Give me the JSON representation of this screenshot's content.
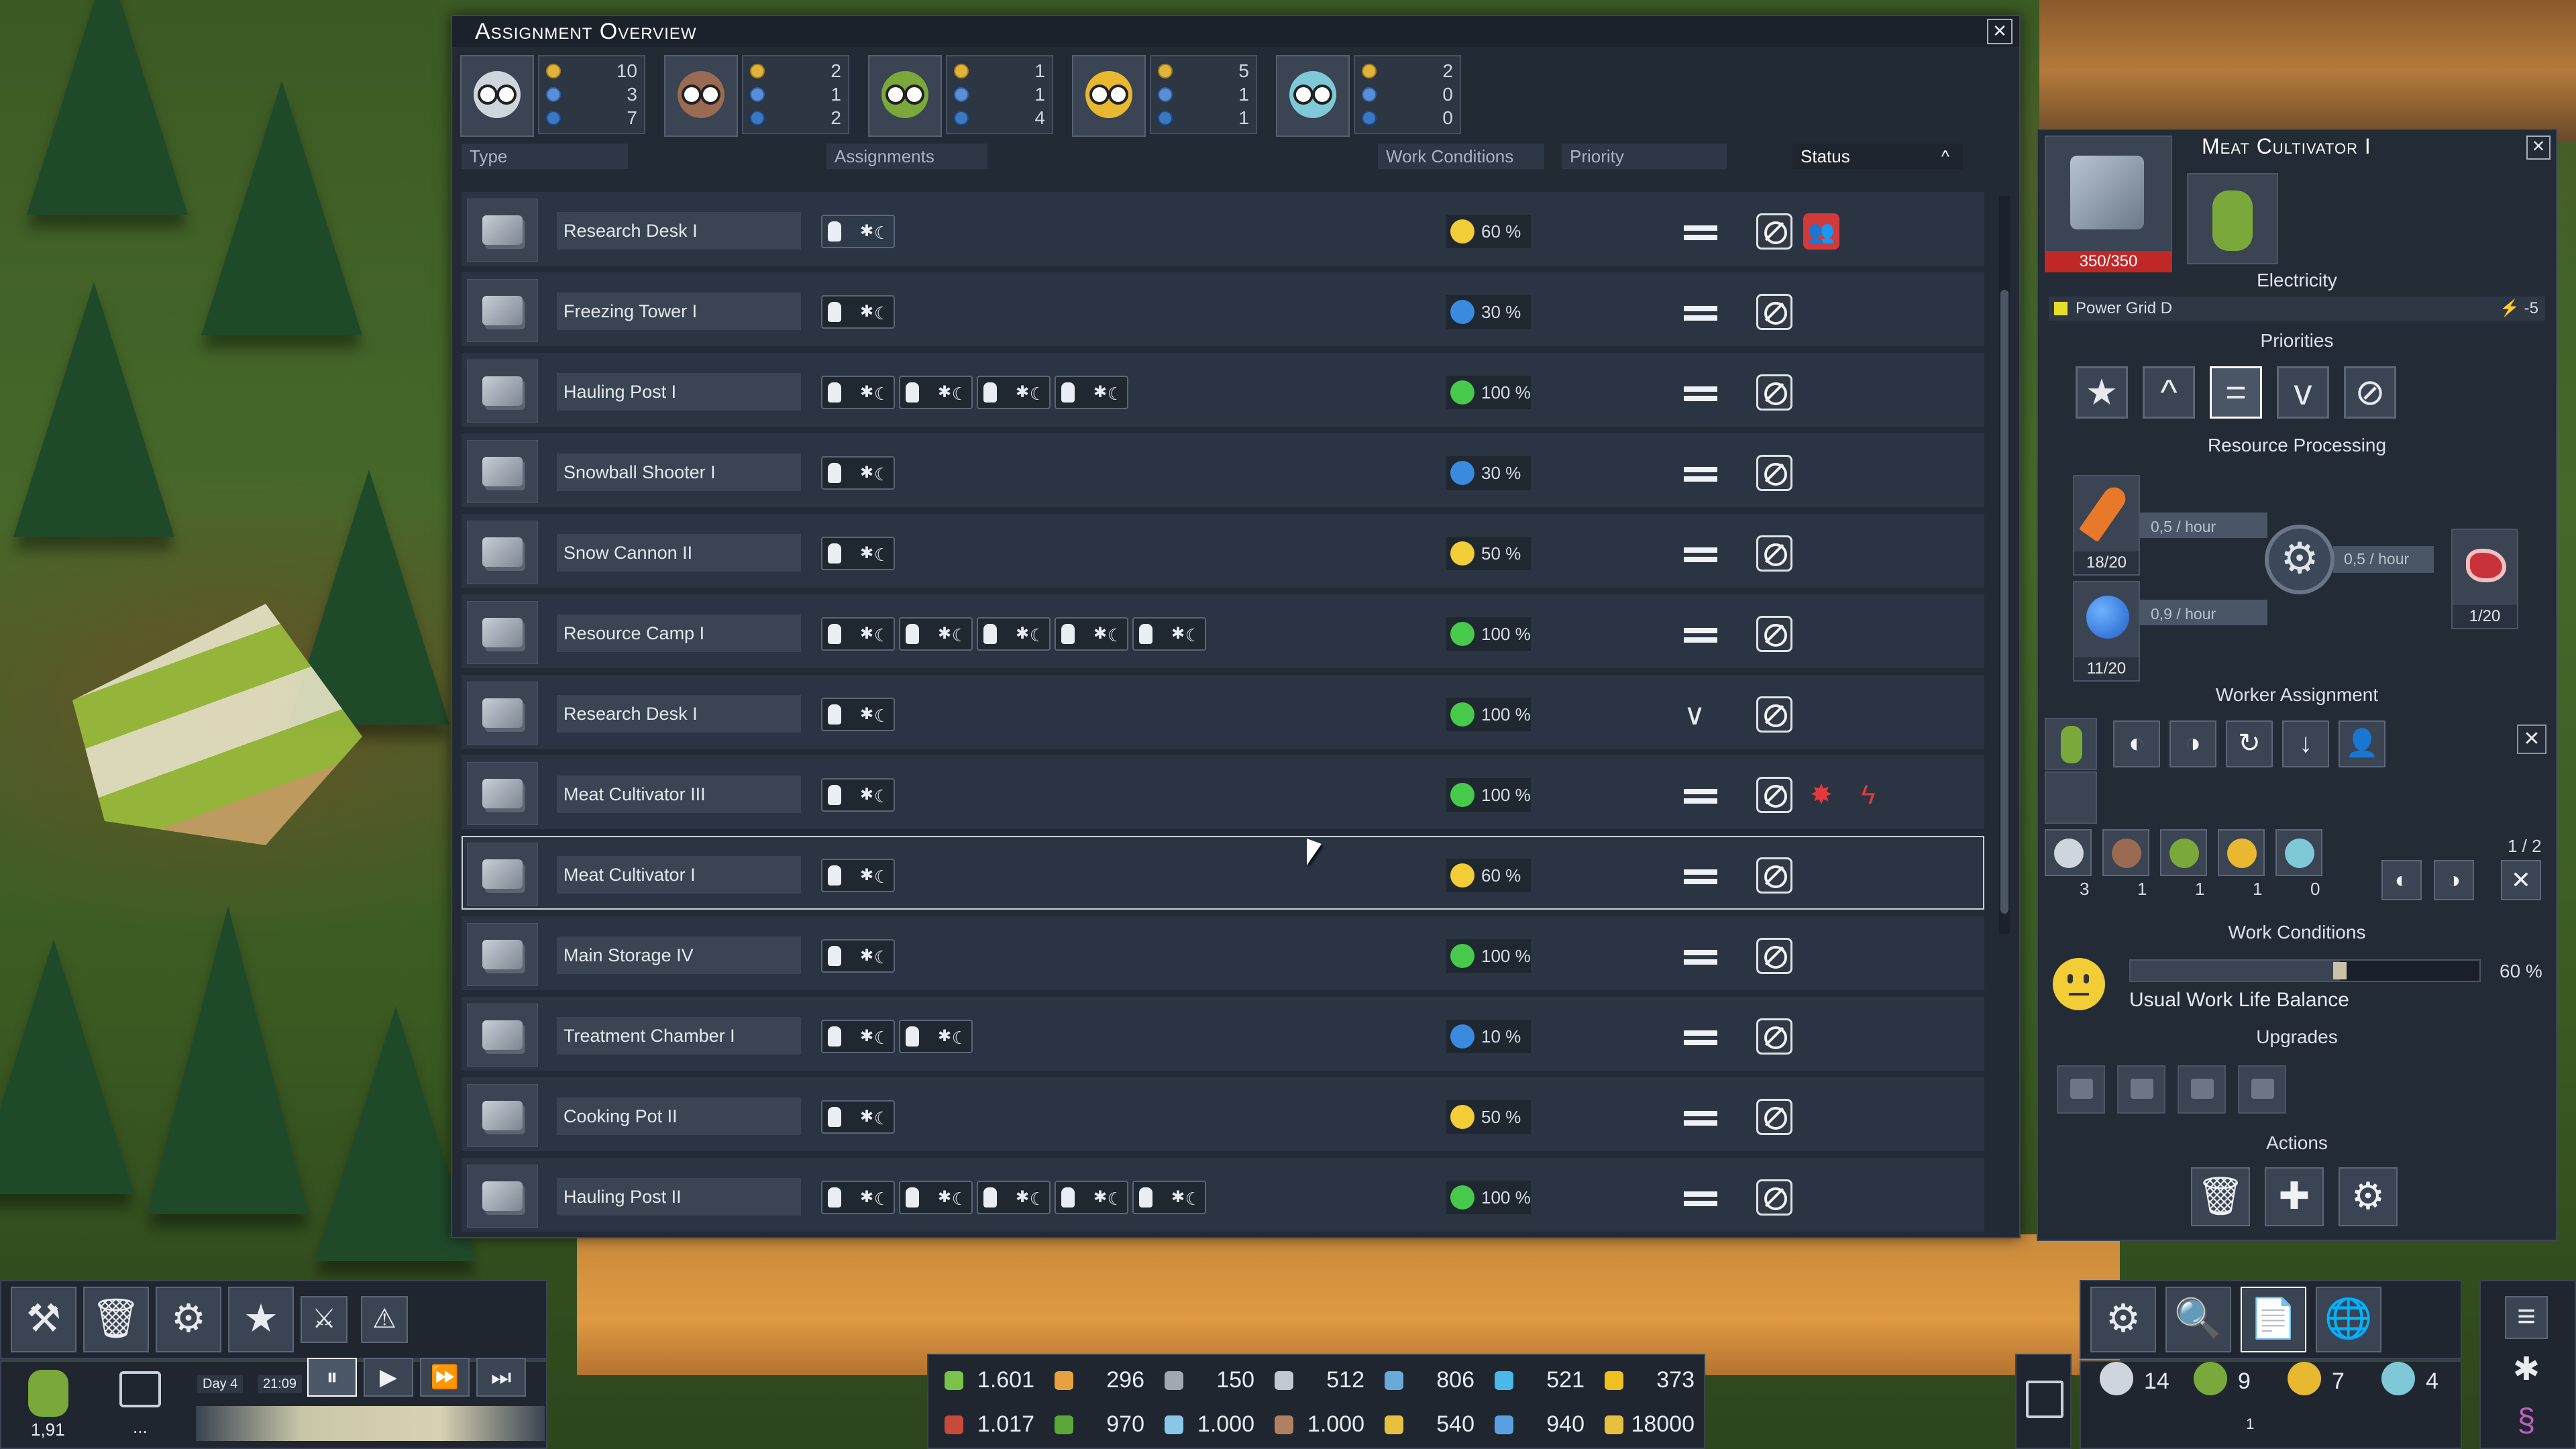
{
  "overview": {
    "title": "Assignment Overview",
    "close": "✕",
    "species": [
      {
        "name": "worker-type-1",
        "color": "#cfd5dc",
        "stats": [
          "10",
          "3",
          "7"
        ]
      },
      {
        "name": "worker-type-2",
        "color": "#9a6a52",
        "stats": [
          "2",
          "1",
          "2"
        ]
      },
      {
        "name": "worker-type-3",
        "color": "#7aa83a",
        "stats": [
          "1",
          "1",
          "4"
        ]
      },
      {
        "name": "worker-type-4",
        "color": "#e8b830",
        "stats": [
          "5",
          "1",
          "1"
        ]
      },
      {
        "name": "worker-type-5",
        "color": "#7fc8d8",
        "stats": [
          "2",
          "0",
          "0"
        ]
      }
    ],
    "columns": {
      "type": "Type",
      "assignments": "Assignments",
      "work_conditions": "Work Conditions",
      "priority": "Priority",
      "status": "Status",
      "status_sort": "^"
    },
    "rows": [
      {
        "name": "Research Desk I",
        "slots": 1,
        "empty": 1,
        "wc": "60 %",
        "mood": "neutral",
        "priority": "equal",
        "status": [
          "ban",
          "red"
        ]
      },
      {
        "name": "Freezing Tower I",
        "slots": 1,
        "empty": 0,
        "wc": "30 %",
        "mood": "sad",
        "priority": "equal",
        "status": [
          "ban"
        ]
      },
      {
        "name": "Hauling Post I",
        "slots": 4,
        "empty": 0,
        "wc": "100 %",
        "mood": "happy",
        "priority": "equal",
        "status": [
          "ban"
        ]
      },
      {
        "name": "Snowball Shooter I",
        "slots": 1,
        "empty": 0,
        "wc": "30 %",
        "mood": "sad",
        "priority": "equal",
        "status": [
          "ban"
        ]
      },
      {
        "name": "Snow Cannon II",
        "slots": 1,
        "empty": 0,
        "wc": "50 %",
        "mood": "neutral",
        "priority": "equal",
        "status": [
          "ban"
        ]
      },
      {
        "name": "Resource Camp I",
        "slots": 5,
        "empty": 0,
        "wc": "100 %",
        "mood": "happy",
        "priority": "equal",
        "status": [
          "ban"
        ]
      },
      {
        "name": "Research Desk I",
        "slots": 1,
        "empty": 0,
        "wc": "100 %",
        "mood": "happy",
        "priority": "low",
        "status": [
          "ban"
        ]
      },
      {
        "name": "Meat Cultivator III",
        "slots": 1,
        "empty": 0,
        "wc": "100 %",
        "mood": "happy",
        "priority": "equal",
        "status": [
          "ban",
          "meat",
          "power"
        ]
      },
      {
        "name": "Meat Cultivator I",
        "slots": 1,
        "empty": 0,
        "wc": "60 %",
        "mood": "neutral",
        "priority": "equal",
        "status": [
          "ban"
        ],
        "selected": true
      },
      {
        "name": "Main Storage IV",
        "slots": 1,
        "empty": 0,
        "wc": "100 %",
        "mood": "happy",
        "priority": "equal",
        "status": [
          "ban"
        ]
      },
      {
        "name": "Treatment Chamber I",
        "slots": 2,
        "empty": 0,
        "wc": "10 %",
        "mood": "sad",
        "priority": "equal",
        "status": [
          "ban"
        ]
      },
      {
        "name": "Cooking Pot II",
        "slots": 1,
        "empty": 0,
        "wc": "50 %",
        "mood": "neutral",
        "priority": "equal",
        "status": [
          "ban"
        ]
      },
      {
        "name": "Hauling Post II",
        "slots": 5,
        "empty": 0,
        "wc": "100 %",
        "mood": "happy",
        "priority": "equal",
        "status": [
          "ban"
        ]
      }
    ]
  },
  "detail": {
    "title": "Meat Cultivator I",
    "hp": "350/350",
    "close": "✕",
    "electricity_title": "Electricity",
    "power_grid": "Power Grid D",
    "power_value": "⚡ -5",
    "priorities_title": "Priorities",
    "priority_buttons": [
      "★",
      "^",
      "=",
      "v",
      "⊘"
    ],
    "resource_processing_title": "Resource Processing",
    "input1": {
      "count": "18/20",
      "rate": "0,5 / hour"
    },
    "input2": {
      "count": "11/20",
      "rate": "0,9 / hour"
    },
    "output": {
      "count": "1/20",
      "rate": "0,5 / hour"
    },
    "gear": "⚙",
    "worker_assignment_title": "Worker Assignment",
    "wa_buttons": [
      "◐",
      "◑",
      "↻",
      "↓",
      "👤"
    ],
    "wa_close": "✕",
    "slot_count": "1 / 2",
    "species_counts": [
      "3",
      "1",
      "1",
      "1",
      "0"
    ],
    "work_conditions_title": "Work Conditions",
    "work_conditions_pct": "60 %",
    "work_conditions_level": 0.6,
    "work_conditions_label": "Usual Work Life Balance",
    "upgrades_title": "Upgrades",
    "actions_title": "Actions",
    "action_buttons": [
      "🗑",
      "✚",
      "⚙"
    ]
  },
  "hud": {
    "left_buttons": [
      "⚒",
      "🗑",
      "⚙",
      "★",
      "⚔",
      "⚠"
    ],
    "colony_value": "1,91",
    "day": "Day 4",
    "time": "21:09",
    "speed_buttons": [
      "⏸",
      "▶",
      "⏩",
      "⏭"
    ],
    "resources": [
      [
        "1.601",
        "#7ac24a"
      ],
      [
        "296",
        "#e8a040"
      ],
      [
        "150",
        "#a0a8b0"
      ],
      [
        "512",
        "#c0c8d0"
      ],
      [
        "806",
        "#6aaad8"
      ],
      [
        "521",
        "#4ab8e8"
      ],
      [
        "373",
        "#f0c020"
      ],
      [
        "1.017",
        "#c84a3a"
      ],
      [
        "970",
        "#5aa838"
      ],
      [
        "1.000",
        "#8ac8e8"
      ],
      [
        "1.000",
        "#b08060"
      ],
      [
        "540",
        "#e8c040"
      ],
      [
        "940",
        "#5aa0e0"
      ],
      [
        "18000",
        "#e8c040"
      ]
    ],
    "right_buttons": [
      "⚙",
      "🔍",
      "📄",
      "🌐"
    ],
    "population": [
      {
        "count": "14",
        "color": "#cfd5dc"
      },
      {
        "count": "9",
        "color": "#7aa83a"
      },
      {
        "count": "7",
        "color": "#e8b830"
      },
      {
        "count": "4",
        "color": "#7fc8d8"
      }
    ],
    "pop_sub": "1",
    "menu_icon": "≡",
    "bug_icon": "✱",
    "dna_icon": "§"
  }
}
